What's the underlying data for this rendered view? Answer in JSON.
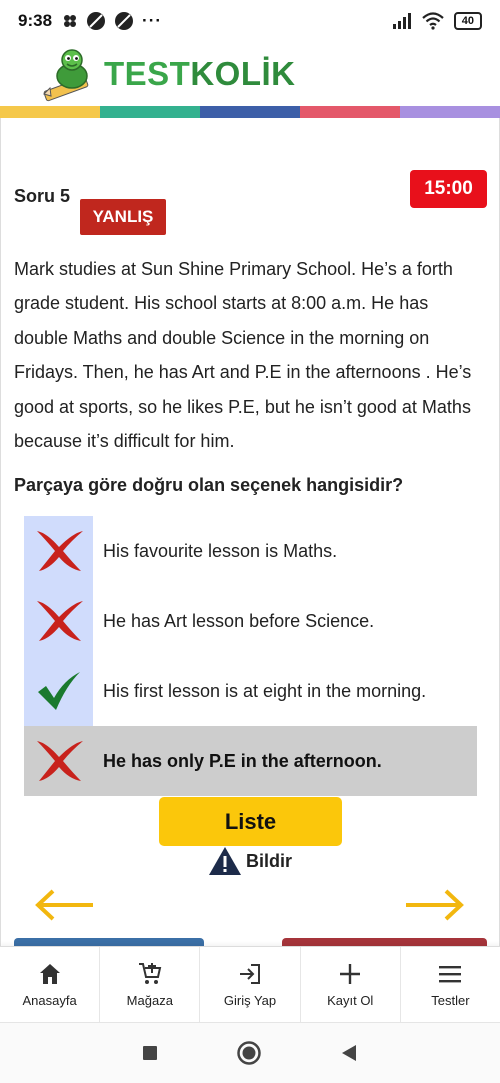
{
  "status_bar": {
    "time": "9:38",
    "battery": "40"
  },
  "brand": {
    "name_part1": "TEST",
    "name_part2": "KOLİK"
  },
  "strip_colors": [
    "#f5c84a",
    "#33b18f",
    "#3d5fa8",
    "#e4586a",
    "#a890e0"
  ],
  "question": {
    "number_label": "Soru 5",
    "result_label": "YANLIŞ",
    "timer": "15:00",
    "passage": "Mark studies at Sun Shine Primary School. He’s a forth grade student. His school starts at 8:00 a.m. He has double Maths and double Science in the morning on Fridays. Then, he has Art and P.E in the afternoons . He’s good at sports, so he likes P.E, but he isn’t good at Maths because it’s difficult for him.",
    "prompt": "Parçaya göre doğru olan seçenek hangisidir?",
    "options": [
      {
        "text": "His favourite lesson is Maths.",
        "mark": "cross-icon",
        "selected": false
      },
      {
        "text": "He has Art lesson before Science.",
        "mark": "cross-icon",
        "selected": false
      },
      {
        "text": "His first lesson is at eight in the morning.",
        "mark": "check-icon",
        "selected": false
      },
      {
        "text": "He has only P.E in the afternoon.",
        "mark": "cross-icon",
        "selected": true
      }
    ]
  },
  "actions": {
    "list_label": "Liste",
    "report_label": "Bildir"
  },
  "bottom_nav": [
    {
      "label": "Anasayfa",
      "icon": "home-icon"
    },
    {
      "label": "Mağaza",
      "icon": "cart-icon"
    },
    {
      "label": "Giriş Yap",
      "icon": "login-icon"
    },
    {
      "label": "Kayıt Ol",
      "icon": "plus-icon"
    },
    {
      "label": "Testler",
      "icon": "menu-icon"
    }
  ],
  "colors": {
    "accent_yellow": "#fbc70b",
    "wrong_red": "#c0271e",
    "timer_red": "#e8101b",
    "option_mark_bg": "#d0dcfc",
    "selected_bg": "#cdcdcd"
  }
}
